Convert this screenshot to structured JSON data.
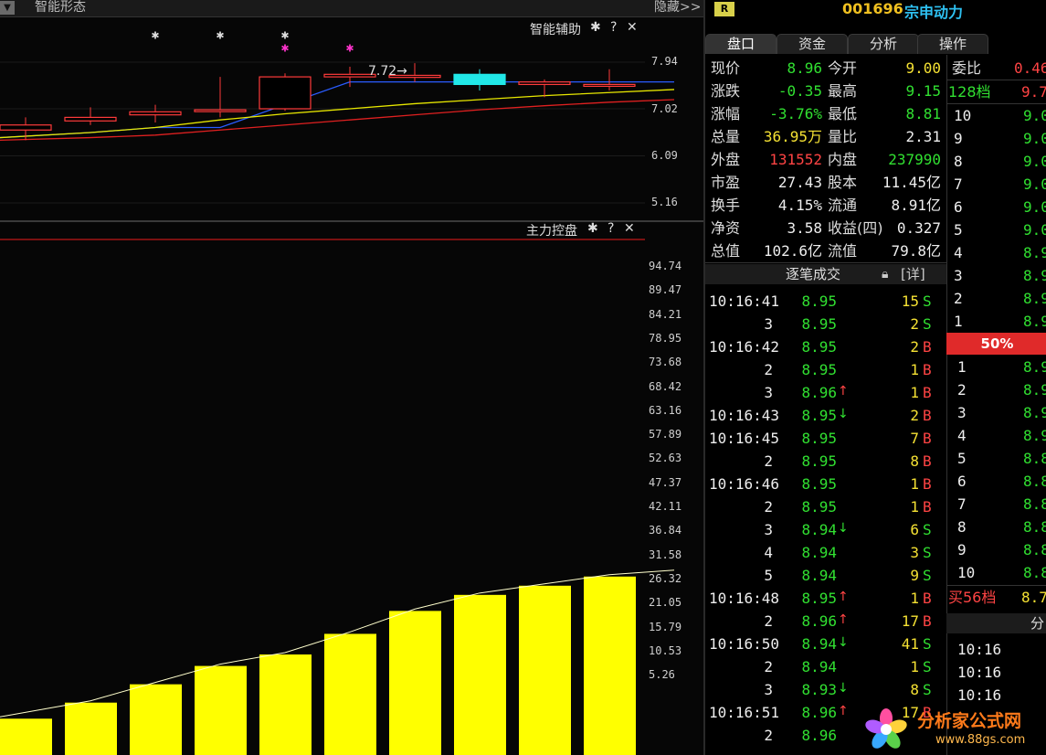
{
  "topbar": {
    "panel_title": "智能形态",
    "hide": "隐藏>>"
  },
  "panels": {
    "upper": {
      "title": "智能辅助",
      "annot": "7.72→",
      "axis": [
        "7.94",
        "7.02",
        "6.09",
        "5.16"
      ]
    },
    "lower": {
      "title": "主力控盘",
      "axis": [
        "94.74",
        "89.47",
        "84.21",
        "78.95",
        "73.68",
        "68.42",
        "63.16",
        "57.89",
        "52.63",
        "47.37",
        "42.11",
        "36.84",
        "31.58",
        "26.32",
        "21.05",
        "15.79",
        "10.53",
        "5.26"
      ]
    }
  },
  "controls": {
    "gear": "✱",
    "help": "?",
    "close": "✕"
  },
  "stock": {
    "badge": "R",
    "code": "001696",
    "name": "宗申动力"
  },
  "tabs": [
    "盘口",
    "资金",
    "分析",
    "操作"
  ],
  "quote": [
    {
      "l1": "现价",
      "v1": "8.96",
      "c1": "g",
      "l2": "今开",
      "v2": "9.00",
      "c2": "y"
    },
    {
      "l1": "涨跌",
      "v1": "-0.35",
      "c1": "g",
      "l2": "最高",
      "v2": "9.15",
      "c2": "g"
    },
    {
      "l1": "涨幅",
      "v1": "-3.76%",
      "c1": "g",
      "l2": "最低",
      "v2": "8.81",
      "c2": "g"
    },
    {
      "l1": "总量",
      "v1": "36.95万",
      "c1": "y",
      "l2": "量比",
      "v2": "2.31",
      "c2": "w"
    },
    {
      "l1": "外盘",
      "v1": "131552",
      "c1": "r",
      "l2": "内盘",
      "v2": "237990",
      "c2": "g"
    },
    {
      "l1": "市盈",
      "v1": "27.43",
      "c1": "w",
      "l2": "股本",
      "v2": "11.45亿",
      "c2": "w"
    },
    {
      "l1": "换手",
      "v1": "4.15%",
      "c1": "w",
      "l2": "流通",
      "v2": "8.91亿",
      "c2": "w"
    },
    {
      "l1": "净资",
      "v1": "3.58",
      "c1": "w",
      "l2": "收益(四)",
      "v2": "0.327",
      "c2": "w"
    },
    {
      "l1": "总值",
      "v1": "102.6亿",
      "c1": "w",
      "l2": "流值",
      "v2": "79.8亿",
      "c2": "w"
    }
  ],
  "ticks_header": {
    "title": "逐笔成交",
    "detail": "[详]"
  },
  "ticks": [
    {
      "t": "10:16:41",
      "p": "8.95",
      "a": "",
      "v": "15",
      "s": "S"
    },
    {
      "t": "3",
      "p": "8.95",
      "a": "",
      "v": "2",
      "s": "S"
    },
    {
      "t": "10:16:42",
      "p": "8.95",
      "a": "",
      "v": "2",
      "s": "B"
    },
    {
      "t": "2",
      "p": "8.95",
      "a": "",
      "v": "1",
      "s": "B"
    },
    {
      "t": "3",
      "p": "8.96",
      "a": "↑",
      "v": "1",
      "s": "B"
    },
    {
      "t": "10:16:43",
      "p": "8.95",
      "a": "↓",
      "v": "2",
      "s": "B"
    },
    {
      "t": "10:16:45",
      "p": "8.95",
      "a": "",
      "v": "7",
      "s": "B"
    },
    {
      "t": "2",
      "p": "8.95",
      "a": "",
      "v": "8",
      "s": "B"
    },
    {
      "t": "10:16:46",
      "p": "8.95",
      "a": "",
      "v": "1",
      "s": "B"
    },
    {
      "t": "2",
      "p": "8.95",
      "a": "",
      "v": "1",
      "s": "B"
    },
    {
      "t": "3",
      "p": "8.94",
      "a": "↓",
      "v": "6",
      "s": "S"
    },
    {
      "t": "4",
      "p": "8.94",
      "a": "",
      "v": "3",
      "s": "S"
    },
    {
      "t": "5",
      "p": "8.94",
      "a": "",
      "v": "9",
      "s": "S"
    },
    {
      "t": "10:16:48",
      "p": "8.95",
      "a": "↑",
      "v": "1",
      "s": "B"
    },
    {
      "t": "2",
      "p": "8.96",
      "a": "↑",
      "v": "17",
      "s": "B"
    },
    {
      "t": "10:16:50",
      "p": "8.94",
      "a": "↓",
      "v": "41",
      "s": "S"
    },
    {
      "t": "2",
      "p": "8.94",
      "a": "",
      "v": "1",
      "s": "S"
    },
    {
      "t": "3",
      "p": "8.93",
      "a": "↓",
      "v": "8",
      "s": "S"
    },
    {
      "t": "10:16:51",
      "p": "8.96",
      "a": "↑",
      "v": "17",
      "s": "B"
    },
    {
      "t": "2",
      "p": "8.96",
      "a": "",
      "v": "",
      "s": ""
    }
  ],
  "book": {
    "ratio_label": "委比",
    "ratio_value": "0.46",
    "ask_label": "128档",
    "ask_value": "9.7",
    "asks": [
      {
        "n": "10",
        "p": "9.0"
      },
      {
        "n": "9",
        "p": "9.0"
      },
      {
        "n": "8",
        "p": "9.0"
      },
      {
        "n": "7",
        "p": "9.0"
      },
      {
        "n": "6",
        "p": "9.0"
      },
      {
        "n": "5",
        "p": "9.0"
      },
      {
        "n": "4",
        "p": "8.9"
      },
      {
        "n": "3",
        "p": "8.9"
      },
      {
        "n": "2",
        "p": "8.9"
      },
      {
        "n": "1",
        "p": "8.9"
      }
    ],
    "mid": "50%",
    "bids": [
      {
        "n": "1",
        "p": "8.9"
      },
      {
        "n": "2",
        "p": "8.9"
      },
      {
        "n": "3",
        "p": "8.9"
      },
      {
        "n": "4",
        "p": "8.9"
      },
      {
        "n": "5",
        "p": "8.8"
      },
      {
        "n": "6",
        "p": "8.8"
      },
      {
        "n": "7",
        "p": "8.8"
      },
      {
        "n": "8",
        "p": "8.8"
      },
      {
        "n": "9",
        "p": "8.8"
      },
      {
        "n": "10",
        "p": "8.8"
      }
    ],
    "buy_label": "买56档",
    "buy_value": "8.7",
    "fen_label": "分",
    "times": [
      "10:16",
      "10:16",
      "10:16"
    ]
  },
  "watermark": {
    "name": "分析家公式网",
    "url": "www.88gs.com"
  },
  "chart_data": [
    {
      "type": "candlestick",
      "title": "智能辅助",
      "y_ticks": [
        7.94,
        7.02,
        6.09,
        5.16
      ],
      "annotation": "7.72→",
      "candles": [
        {
          "o": 6.7,
          "c": 6.6,
          "h": 6.85,
          "l": 6.4,
          "up": true
        },
        {
          "o": 6.85,
          "c": 6.78,
          "h": 7.05,
          "l": 6.7,
          "up": true
        },
        {
          "o": 6.96,
          "c": 6.9,
          "h": 7.1,
          "l": 6.75,
          "up": true
        },
        {
          "o": 7.0,
          "c": 7.0,
          "h": 7.65,
          "l": 6.85,
          "up": true
        },
        {
          "o": 7.65,
          "c": 7.02,
          "h": 7.72,
          "l": 6.98,
          "up": true
        },
        {
          "o": 7.7,
          "c": 7.65,
          "h": 7.85,
          "l": 7.45,
          "up": true
        },
        {
          "o": 7.68,
          "c": 7.64,
          "h": 7.92,
          "l": 7.55,
          "up": true
        },
        {
          "o": 7.7,
          "c": 7.5,
          "h": 7.8,
          "l": 7.38,
          "up": false
        },
        {
          "o": 7.55,
          "c": 7.5,
          "h": 7.6,
          "l": 7.25,
          "up": true
        },
        {
          "o": 7.5,
          "c": 7.48,
          "h": 7.8,
          "l": 7.38,
          "up": true
        }
      ],
      "markers": [
        {
          "i": 2,
          "v": 8.4,
          "color": "#dddddd"
        },
        {
          "i": 3,
          "v": 8.4,
          "color": "#dddddd"
        },
        {
          "i": 4,
          "v": 8.4,
          "color": "#dddddd"
        },
        {
          "i": 4,
          "v": 8.15,
          "color": "#ff33cc"
        },
        {
          "i": 5,
          "v": 8.15,
          "color": "#ff33cc"
        }
      ],
      "lines": [
        {
          "color": "#2a5cff",
          "values": [
            6.45,
            6.55,
            6.65,
            6.65,
            7.1,
            7.55,
            7.55,
            7.55,
            7.55,
            7.55,
            7.55
          ]
        },
        {
          "color": "#e8e800",
          "values": [
            6.45,
            6.55,
            6.65,
            6.8,
            6.92,
            7.02,
            7.12,
            7.2,
            7.28,
            7.34,
            7.4
          ]
        },
        {
          "color": "#e02020",
          "values": [
            6.4,
            6.45,
            6.5,
            6.6,
            6.7,
            6.8,
            6.9,
            7.0,
            7.08,
            7.15,
            7.2
          ]
        }
      ]
    },
    {
      "type": "bar",
      "title": "主力控盘",
      "y_ticks": [
        94.74,
        89.47,
        84.21,
        78.95,
        73.68,
        68.42,
        63.16,
        57.89,
        52.63,
        47.37,
        42.11,
        36.84,
        31.58,
        26.32,
        21.05,
        15.79,
        10.53,
        5.26
      ],
      "values": [
        8.0,
        11.5,
        15.5,
        19.5,
        22.0,
        26.5,
        31.5,
        35.0,
        37.0,
        39.0
      ],
      "color": "#ffff00",
      "line_values": [
        8.0,
        11.5,
        15.5,
        19.5,
        22.0,
        26.5,
        31.5,
        35.0,
        37.0,
        39.0,
        40.0
      ]
    }
  ]
}
